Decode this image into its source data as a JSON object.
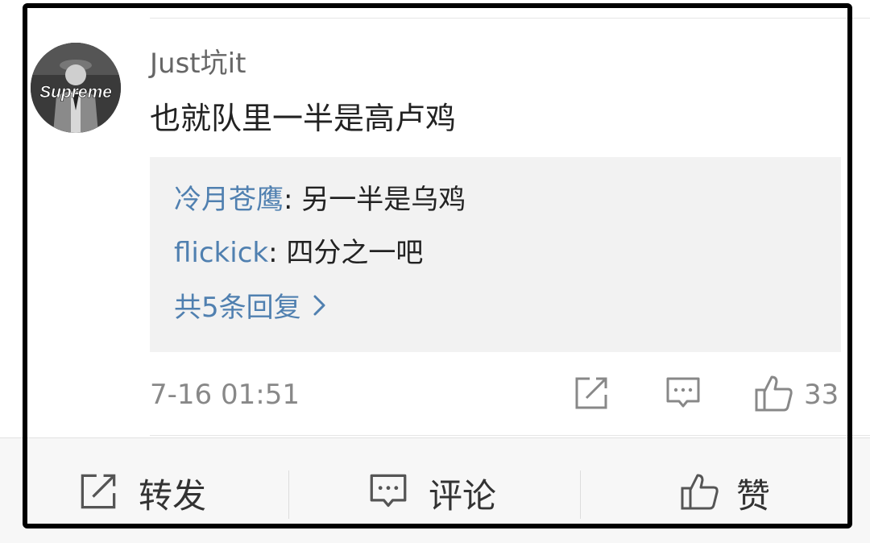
{
  "comment": {
    "avatar_text": "Supreme",
    "username": "Just坑it",
    "text": "也就队里一半是高卢鸡",
    "timestamp": "7-16 01:51",
    "like_count": "33"
  },
  "replies": [
    {
      "name": "冷月苍鹰",
      "text": ": 另一半是乌鸡"
    },
    {
      "name": "flickick",
      "text": ": 四分之一吧"
    }
  ],
  "replies_more": "共5条回复",
  "bottom_bar": {
    "forward_label": "转发",
    "comment_label": "评论",
    "like_label": "赞"
  },
  "icons": {
    "forward": "share-icon",
    "comment": "comment-icon",
    "like": "thumbs-up-icon",
    "more": "chevron-right-icon"
  },
  "colors": {
    "link": "#5080b0",
    "reply_bg": "#f2f2f2",
    "muted": "#888888"
  }
}
